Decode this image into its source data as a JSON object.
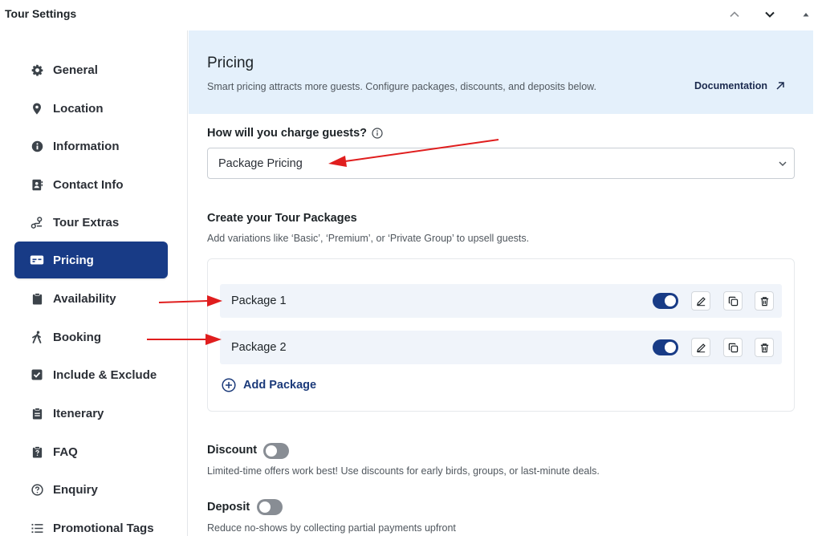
{
  "window": {
    "title": "Tour Settings"
  },
  "sidebar": {
    "items": [
      {
        "label": "General",
        "icon": "gear-icon"
      },
      {
        "label": "Location",
        "icon": "map-pin-icon"
      },
      {
        "label": "Information",
        "icon": "info-icon"
      },
      {
        "label": "Contact Info",
        "icon": "contact-card-icon"
      },
      {
        "label": "Tour Extras",
        "icon": "route-icon"
      },
      {
        "label": "Pricing",
        "icon": "ticket-icon",
        "active": true
      },
      {
        "label": "Availability",
        "icon": "clipboard-icon"
      },
      {
        "label": "Booking",
        "icon": "walking-person-icon"
      },
      {
        "label": "Include & Exclude",
        "icon": "check-square-icon"
      },
      {
        "label": "Itenerary",
        "icon": "list-clipboard-icon"
      },
      {
        "label": "FAQ",
        "icon": "question-clipboard-icon"
      },
      {
        "label": "Enquiry",
        "icon": "question-circle-icon"
      },
      {
        "label": "Promotional Tags",
        "icon": "list-icon"
      }
    ]
  },
  "main": {
    "title": "Pricing",
    "description": "Smart pricing attracts more guests. Configure packages, discounts, and deposits below.",
    "documentation_label": "Documentation",
    "charge_question": "How will you charge guests?",
    "charge_select_value": "Package Pricing",
    "packages_title": "Create your Tour Packages",
    "packages_description": "Add variations like ‘Basic’, ‘Premium’, or ‘Private Group’ to upsell guests.",
    "packages": [
      {
        "name": "Package 1",
        "enabled": true
      },
      {
        "name": "Package 2",
        "enabled": true
      }
    ],
    "add_package_label": "Add Package",
    "discount": {
      "label": "Discount",
      "enabled": false,
      "description": "Limited-time offers work best! Use discounts for early birds, groups, or last-minute deals."
    },
    "deposit": {
      "label": "Deposit",
      "enabled": false,
      "description": "Reduce no-shows by collecting partial payments upfront"
    }
  },
  "colors": {
    "accent": "#183b86",
    "header_band": "#e4f0fb",
    "annotation_arrow": "#e01e1e"
  }
}
